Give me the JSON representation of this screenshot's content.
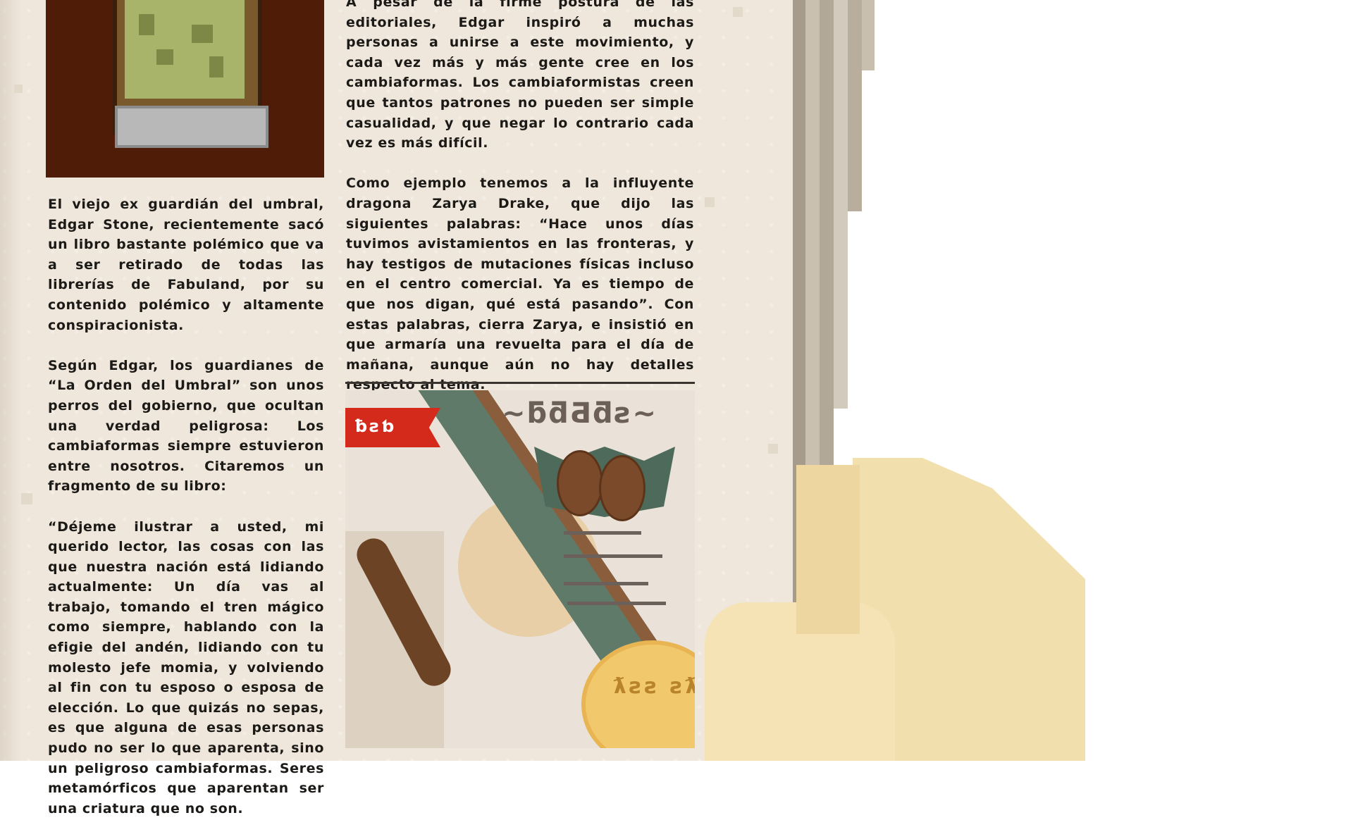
{
  "left_column": {
    "paragraphs": [
      "El viejo ex guardián del umbral, Edgar Stone, recientemente sacó un libro bastante polémico que va a ser retirado de todas las librerías de Fabuland, por su contenido polémico y altamente conspiracionista.",
      "Según Edgar, los guardianes de “La Orden del Umbral” son unos perros del gobierno, que ocultan una verdad peligrosa: Los cambiaformas siempre estuvieron entre nosotros. Citaremos un fragmento de su libro:",
      "“Déjeme ilustrar a usted, mi querido lector, las cosas con las que nuestra nación está lidiando actualmente: Un día vas al trabajo, tomando el tren mágico como siempre, hablando con la efigie del andén, lidiando con tu molesto jefe momia, y volviendo al fin con tu esposo o esposa de elección. Lo que quizás no sepas, es que alguna de esas personas pudo no ser lo que aparenta, sino un peligroso cambiaformas. Seres metamórficos que aparentan ser una criatura que no son."
    ]
  },
  "right_column": {
    "paragraphs": [
      "A pesar de la firme postura de las editoriales, Edgar inspiró a muchas personas a unirse a este movimiento, y cada vez más y más gente cree en los cambiaformas. Los cambiaformistas creen que tantos patrones no pueden ser simple casualidad, y que negar lo contrario cada vez es más difícil.",
      "Como ejemplo tenemos a la influyente dragona Zarya Drake, que dijo las siguientes palabras: “Hace unos días tuvimos avistamientos en las fronteras, y hay testigos de mutaciones físicas incluso en el centro comercial. Ya es tiempo de que nos digan, qué está pasando”. Con estas palabras, cierra Zarya, e insistió en que armaría una revuelta para el día de mañana, aunque aún no hay detalles respecto al tema."
    ]
  },
  "ad": {
    "banner_glyphs": "ƀƨƅ",
    "title_glyphs": "~ƃƌƋƌƨ~",
    "cookie_glyphs": "ƛƨƨ ƨƛƨ"
  },
  "colors": {
    "paper": "#efe7dc",
    "ink": "#1c1a17",
    "banner_red": "#d42a1c",
    "hand": "#f2dfae"
  }
}
